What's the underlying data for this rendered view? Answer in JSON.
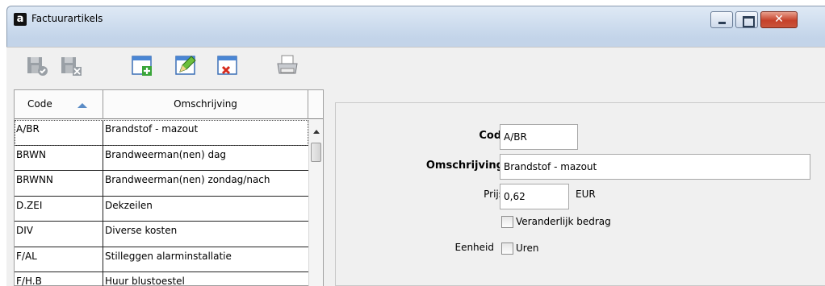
{
  "window": {
    "title": "Factuurartikels",
    "app_icon_letter": "a"
  },
  "toolbar": {
    "buttons": [
      {
        "name": "save-record-icon"
      },
      {
        "name": "cancel-record-icon"
      },
      {
        "name": "new-record-icon"
      },
      {
        "name": "edit-record-icon"
      },
      {
        "name": "delete-record-icon"
      },
      {
        "name": "print-icon"
      }
    ]
  },
  "grid": {
    "columns": [
      "Code",
      "Omschrijving"
    ],
    "sort_column": "Code",
    "sort_direction": "ascending",
    "rows": [
      {
        "code": "A/BR",
        "desc": "Brandstof - mazout"
      },
      {
        "code": "BRWN",
        "desc": "Brandweerman(nen) dag"
      },
      {
        "code": "BRWNN",
        "desc": "Brandweerman(nen) zondag/nach"
      },
      {
        "code": "D.ZEI",
        "desc": "Dekzeilen"
      },
      {
        "code": "DIV",
        "desc": "Diverse kosten"
      },
      {
        "code": "F/AL",
        "desc": "Stilleggen alarminstallatie"
      },
      {
        "code": "F/H.B",
        "desc": "Huur blustoestel"
      }
    ]
  },
  "detail": {
    "code_label": "Code",
    "code_value": "A/BR",
    "desc_label": "Omschrijving",
    "desc_value": "Brandstof - mazout",
    "price_label": "Prijs",
    "price_value": "0,62",
    "currency": "EUR",
    "variable_label": "Veranderlijk bedrag",
    "variable_checked": false,
    "unit_label": "Eenheid",
    "unit_option_label": "Uren",
    "unit_checked": false
  }
}
